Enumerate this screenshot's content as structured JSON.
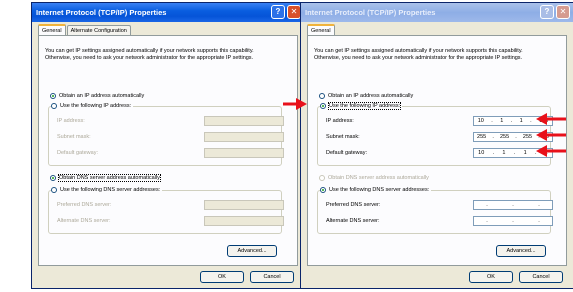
{
  "left": {
    "title": "Internet Protocol (TCP/IP) Properties",
    "help": "?",
    "close": "✕",
    "tabs": [
      "General",
      "Alternate Configuration"
    ],
    "description": "You can get IP settings assigned automatically if your network supports this capability. Otherwise, you need to ask your network administrator for the appropriate IP settings.",
    "obtain_ip": "Obtain an IP address automatically",
    "use_ip": "Use the following IP address:",
    "ip_label": "IP address:",
    "mask_label": "Subnet mask:",
    "gw_label": "Default gateway:",
    "obtain_dns": "Obtain DNS server address automatically",
    "use_dns": "Use the following DNS server addresses:",
    "pref_dns": "Preferred DNS server:",
    "alt_dns": "Alternate DNS server:",
    "advanced": "Advanced...",
    "ok": "OK",
    "cancel": "Cancel"
  },
  "right": {
    "title": "Internet Protocol (TCP/IP) Properties",
    "help": "?",
    "close": "✕",
    "tabs": [
      "General"
    ],
    "description": "You can get IP settings assigned automatically if your network supports this capability. Otherwise, you need to ask your network administrator for the appropriate IP settings.",
    "obtain_ip": "Obtain an IP address automatically",
    "use_ip": "Use the following IP address:",
    "ip_label": "IP address:",
    "mask_label": "Subnet mask:",
    "gw_label": "Default gateway:",
    "ip": [
      "10",
      "1",
      "1",
      "100"
    ],
    "mask": [
      "255",
      "255",
      "255",
      "0"
    ],
    "gw": [
      "10",
      "1",
      "1",
      "1"
    ],
    "obtain_dns": "Obtain DNS server address automatically",
    "use_dns": "Use the following DNS server addresses:",
    "pref_dns": "Preferred DNS server:",
    "alt_dns": "Alternate DNS server:",
    "advanced": "Advanced...",
    "ok": "OK",
    "cancel": "Cancel"
  },
  "colors": {
    "arrow": "#e8101a",
    "titlebar_active": "#0554d8",
    "titlebar_inactive": "#9db8ea"
  },
  "icons": {
    "annotation": "red-arrow-icon"
  }
}
